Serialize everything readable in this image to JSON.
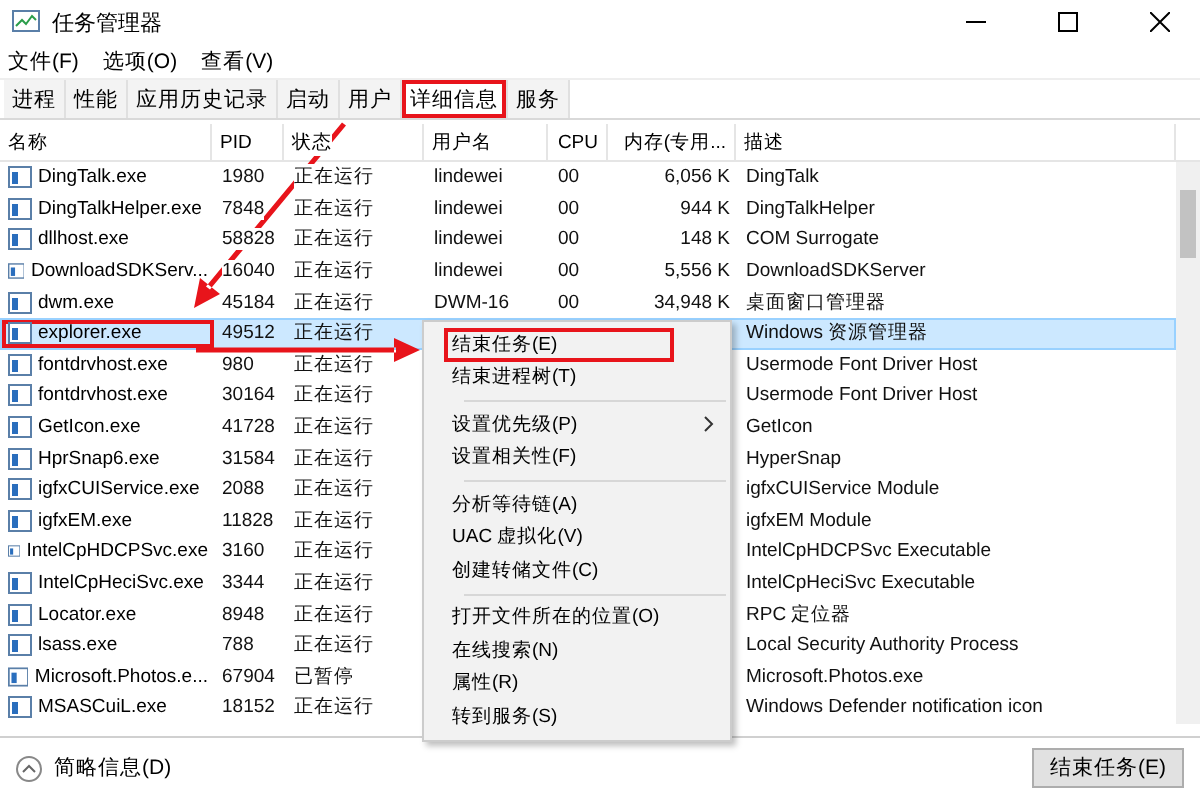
{
  "window": {
    "title": "任务管理器"
  },
  "menu_bar": [
    "文件(F)",
    "选项(O)",
    "查看(V)"
  ],
  "tabs": [
    {
      "label": "进程",
      "selected": false,
      "annotated": false
    },
    {
      "label": "性能",
      "selected": false,
      "annotated": false
    },
    {
      "label": "应用历史记录",
      "selected": false,
      "annotated": false
    },
    {
      "label": "启动",
      "selected": false,
      "annotated": false
    },
    {
      "label": "用户",
      "selected": false,
      "annotated": false
    },
    {
      "label": "详细信息",
      "selected": true,
      "annotated": true
    },
    {
      "label": "服务",
      "selected": false,
      "annotated": false
    }
  ],
  "table": {
    "columns": [
      "名称",
      "PID",
      "状态",
      "用户名",
      "CPU",
      "内存(专用...",
      "描述"
    ],
    "rows": [
      {
        "name": "DingTalk.exe",
        "pid": "1980",
        "status": "正在运行",
        "user": "lindewei",
        "cpu": "00",
        "memory": "6,056 K",
        "description": "DingTalk",
        "selected": false,
        "annotated": false
      },
      {
        "name": "DingTalkHelper.exe",
        "pid": "7848",
        "status": "正在运行",
        "user": "lindewei",
        "cpu": "00",
        "memory": "944 K",
        "description": "DingTalkHelper",
        "selected": false,
        "annotated": false
      },
      {
        "name": "dllhost.exe",
        "pid": "58828",
        "status": "正在运行",
        "user": "lindewei",
        "cpu": "00",
        "memory": "148 K",
        "description": "COM Surrogate",
        "selected": false,
        "annotated": false
      },
      {
        "name": "DownloadSDKServ...",
        "pid": "16040",
        "status": "正在运行",
        "user": "lindewei",
        "cpu": "00",
        "memory": "5,556 K",
        "description": "DownloadSDKServer",
        "selected": false,
        "annotated": false
      },
      {
        "name": "dwm.exe",
        "pid": "45184",
        "status": "正在运行",
        "user": "DWM-16",
        "cpu": "00",
        "memory": "34,948 K",
        "description": "桌面窗口管理器",
        "selected": false,
        "annotated": false
      },
      {
        "name": "explorer.exe",
        "pid": "49512",
        "status": "正在运行",
        "description": "Windows 资源管理器",
        "selected": true,
        "annotated": true
      },
      {
        "name": "fontdrvhost.exe",
        "pid": "980",
        "status": "正在运行",
        "description": "Usermode Font Driver Host",
        "selected": false,
        "annotated": false
      },
      {
        "name": "fontdrvhost.exe",
        "pid": "30164",
        "status": "正在运行",
        "description": "Usermode Font Driver Host",
        "selected": false,
        "annotated": false
      },
      {
        "name": "GetIcon.exe",
        "pid": "41728",
        "status": "正在运行",
        "description": "GetIcon",
        "selected": false,
        "annotated": false
      },
      {
        "name": "HprSnap6.exe",
        "pid": "31584",
        "status": "正在运行",
        "description": "HyperSnap",
        "selected": false,
        "annotated": false
      },
      {
        "name": "igfxCUIService.exe",
        "pid": "2088",
        "status": "正在运行",
        "description": "igfxCUIService Module",
        "selected": false,
        "annotated": false
      },
      {
        "name": "igfxEM.exe",
        "pid": "11828",
        "status": "正在运行",
        "description": "igfxEM Module",
        "selected": false,
        "annotated": false
      },
      {
        "name": "IntelCpHDCPSvc.exe",
        "pid": "3160",
        "status": "正在运行",
        "description": "IntelCpHDCPSvc Executable",
        "selected": false,
        "annotated": false
      },
      {
        "name": "IntelCpHeciSvc.exe",
        "pid": "3344",
        "status": "正在运行",
        "description": "IntelCpHeciSvc Executable",
        "selected": false,
        "annotated": false
      },
      {
        "name": "Locator.exe",
        "pid": "8948",
        "status": "正在运行",
        "description": "RPC 定位器",
        "selected": false,
        "annotated": false
      },
      {
        "name": "lsass.exe",
        "pid": "788",
        "status": "正在运行",
        "description": "Local Security Authority Process",
        "selected": false,
        "annotated": false
      },
      {
        "name": "Microsoft.Photos.e...",
        "pid": "67904",
        "status": "已暂停",
        "description": "Microsoft.Photos.exe",
        "selected": false,
        "annotated": false
      },
      {
        "name": "MSASCuiL.exe",
        "pid": "18152",
        "status": "正在运行",
        "description": "Windows Defender notification icon",
        "selected": false,
        "annotated": false
      }
    ]
  },
  "context_menu": {
    "groups": [
      [
        {
          "label": "结束任务(E)",
          "submenu": false,
          "annotated": true
        },
        {
          "label": "结束进程树(T)",
          "submenu": false,
          "annotated": false
        }
      ],
      [
        {
          "label": "设置优先级(P)",
          "submenu": true,
          "annotated": false
        },
        {
          "label": "设置相关性(F)",
          "submenu": false,
          "annotated": false
        }
      ],
      [
        {
          "label": "分析等待链(A)",
          "submenu": false,
          "annotated": false
        },
        {
          "label": "UAC 虚拟化(V)",
          "submenu": false,
          "annotated": false
        },
        {
          "label": "创建转储文件(C)",
          "submenu": false,
          "annotated": false
        }
      ],
      [
        {
          "label": "打开文件所在的位置(O)",
          "submenu": false,
          "annotated": false
        },
        {
          "label": "在线搜索(N)",
          "submenu": false,
          "annotated": false
        },
        {
          "label": "属性(R)",
          "submenu": false,
          "annotated": false
        },
        {
          "label": "转到服务(S)",
          "submenu": false,
          "annotated": false
        }
      ]
    ]
  },
  "footer": {
    "toggle_label": "简略信息(D)",
    "end_task_button": "结束任务(E)"
  }
}
